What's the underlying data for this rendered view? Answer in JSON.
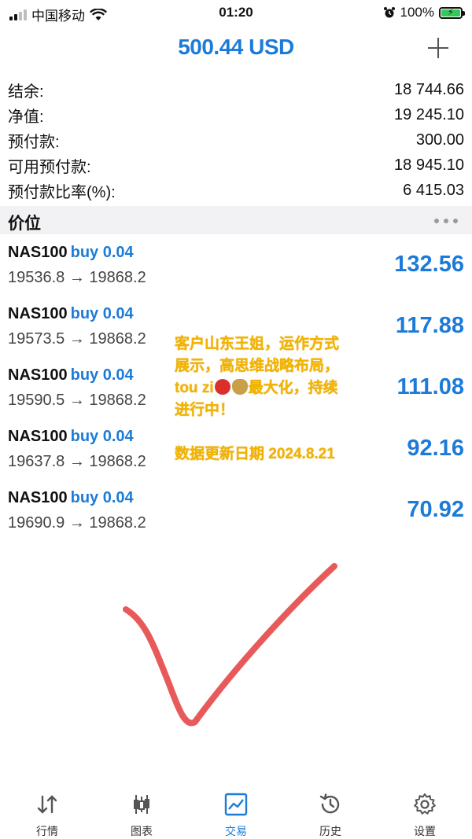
{
  "status_bar": {
    "carrier": "中国移动",
    "time": "01:20",
    "battery": "100%"
  },
  "header": {
    "title": "500.44 USD",
    "add_icon": "plus-icon"
  },
  "summary": [
    {
      "label": "结余:",
      "value": "18 744.66"
    },
    {
      "label": "净值:",
      "value": "19 245.10"
    },
    {
      "label": "预付款:",
      "value": "300.00"
    },
    {
      "label": "可用预付款:",
      "value": "18 945.10"
    },
    {
      "label": "预付款比率(%):",
      "value": "6 415.03"
    }
  ],
  "section": {
    "title": "价位",
    "more_icon": "more-dots-icon"
  },
  "positions": [
    {
      "symbol": "NAS100",
      "direction": "buy 0.04",
      "prices": "19536.8 → 19868.2",
      "profit": "132.56"
    },
    {
      "symbol": "NAS100",
      "direction": "buy 0.04",
      "prices": "19573.5 → 19868.2",
      "profit": "117.88"
    },
    {
      "symbol": "NAS100",
      "direction": "buy 0.04",
      "prices": "19590.5 → 19868.2",
      "profit": "111.08"
    },
    {
      "symbol": "NAS100",
      "direction": "buy 0.04",
      "prices": "19637.8 → 19868.2",
      "profit": "92.16"
    },
    {
      "symbol": "NAS100",
      "direction": "buy 0.04",
      "prices": "19690.9 → 19868.2",
      "profit": "70.92"
    }
  ],
  "overlay": {
    "line1": "客户山东王姐，运作方式",
    "line2": "展示，高思维战略布局，",
    "line3_prefix": "tou zi",
    "line3_suffix": "最大化，持续",
    "line4": "进行中！",
    "date_line": "数据更新日期 2024.8.21",
    "emoji_1": "得-emoji",
    "emoji_2": "money-bag-emoji"
  },
  "tabs": [
    {
      "label": "行情",
      "icon": "quotes-arrows-icon"
    },
    {
      "label": "图表",
      "icon": "candlestick-chart-icon"
    },
    {
      "label": "交易",
      "icon": "trade-chart-icon",
      "active": true
    },
    {
      "label": "历史",
      "icon": "history-clock-icon"
    },
    {
      "label": "设置",
      "icon": "settings-gear-icon"
    }
  ],
  "colors": {
    "accent": "#1d7bd8",
    "overlay_text": "#f2b300",
    "checkmark": "#e85a5a"
  }
}
